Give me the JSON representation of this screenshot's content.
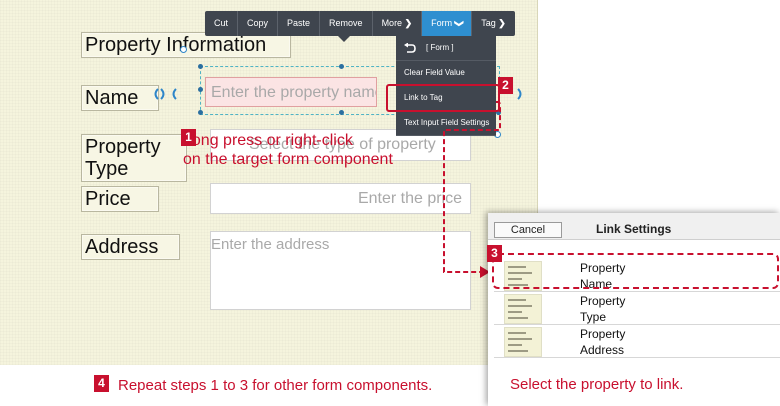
{
  "form": {
    "heading": "Property Information",
    "fields": {
      "name": {
        "label": "Name",
        "placeholder": "Enter the property name"
      },
      "type": {
        "label": "Property Type",
        "placeholder": "Select the type of property"
      },
      "price": {
        "label": "Price",
        "placeholder": "Enter the price"
      },
      "address": {
        "label": "Address",
        "placeholder": "Enter the address"
      }
    }
  },
  "toolbar": {
    "items": [
      "Cut",
      "Copy",
      "Paste",
      "Remove",
      "More",
      "Form",
      "Tag"
    ],
    "active": "Form",
    "colors": {
      "bg": "#3f454e",
      "active": "#2e8fd0"
    }
  },
  "context_menu": {
    "back_label": "[ Form ]",
    "items": [
      "Clear Field Value",
      "Link to Tag",
      "Text Input Field Settings"
    ]
  },
  "annotations": {
    "step1_num": "1",
    "step1_text": "Long press or right-click\non the target form component",
    "step2_num": "2",
    "step3_num": "3",
    "step4_num": "4",
    "step4_text": "Repeat steps 1 to 3 for other form components.",
    "panel_hint": "Select the property to link.",
    "accent_color": "#c8102e"
  },
  "link_settings": {
    "title": "Link Settings",
    "cancel_label": "Cancel",
    "rows": [
      {
        "line1": "Property",
        "line2": "Name"
      },
      {
        "line1": "Property",
        "line2": "Type"
      },
      {
        "line1": "Property",
        "line2": "Address"
      }
    ]
  }
}
